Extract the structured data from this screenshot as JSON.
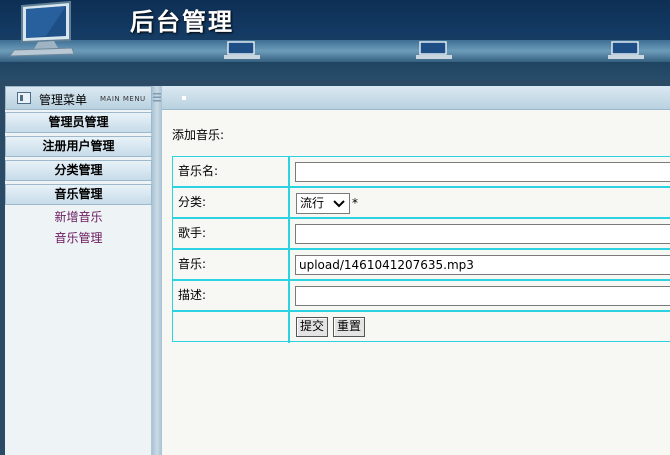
{
  "header": {
    "title": "后台管理"
  },
  "sidebar": {
    "menu_label": "管理菜单",
    "menu_sub": "MAIN MENU",
    "sections": [
      {
        "label": "管理员管理"
      },
      {
        "label": "注册用户管理"
      },
      {
        "label": "分类管理"
      },
      {
        "label": "音乐管理"
      }
    ],
    "links": [
      {
        "label": "新增音乐"
      },
      {
        "label": "音乐管理"
      }
    ]
  },
  "main": {
    "page_title": "添加音乐:",
    "form": {
      "name_label": "音乐名:",
      "name_value": "",
      "category_label": "分类:",
      "category_selected": "流行",
      "required_mark": "*",
      "singer_label": "歌手:",
      "singer_value": "",
      "file_label": "音乐:",
      "file_value": "upload/1461041207635.mp3",
      "desc_label": "描述:",
      "desc_value": "",
      "submit_label": "提交",
      "reset_label": "重置"
    }
  },
  "colors": {
    "table_border": "#2bd2e0",
    "link": "#6a1b5e",
    "header_bg": "#133a63"
  }
}
